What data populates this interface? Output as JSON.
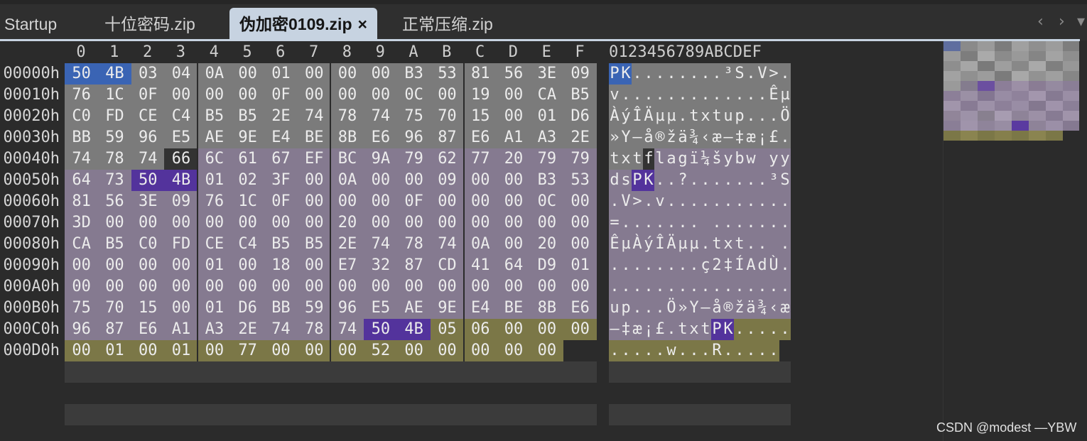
{
  "tabs": [
    {
      "label": "Startup",
      "active": false
    },
    {
      "label": "十位密码.zip",
      "active": false
    },
    {
      "label": "伪加密0109.zip",
      "active": true,
      "close_glyph": "×"
    },
    {
      "label": "正常压缩.zip",
      "active": false
    }
  ],
  "nav": {
    "prev_glyph": "‹",
    "next_glyph": "›",
    "menu_glyph": "▾"
  },
  "hex_view": {
    "column_headers": [
      "0",
      "1",
      "2",
      "3",
      "4",
      "5",
      "6",
      "7",
      "8",
      "9",
      "A",
      "B",
      "C",
      "D",
      "E",
      "F"
    ],
    "ascii_header": "0123456789ABCDEF",
    "rows": [
      {
        "offset": "00000h",
        "bytes": [
          "50",
          "4B",
          "03",
          "04",
          "0A",
          "00",
          "01",
          "00",
          "00",
          "00",
          "B3",
          "53",
          "81",
          "56",
          "3E",
          "09"
        ],
        "ascii": "PK........³S.V>."
      },
      {
        "offset": "00010h",
        "bytes": [
          "76",
          "1C",
          "0F",
          "00",
          "00",
          "00",
          "0F",
          "00",
          "00",
          "00",
          "0C",
          "00",
          "19",
          "00",
          "CA",
          "B5"
        ],
        "ascii": "v.............Êµ"
      },
      {
        "offset": "00020h",
        "bytes": [
          "C0",
          "FD",
          "CE",
          "C4",
          "B5",
          "B5",
          "2E",
          "74",
          "78",
          "74",
          "75",
          "70",
          "15",
          "00",
          "01",
          "D6"
        ],
        "ascii": "ÀýÎÄµµ.txtup...Ö"
      },
      {
        "offset": "00030h",
        "bytes": [
          "BB",
          "59",
          "96",
          "E5",
          "AE",
          "9E",
          "E4",
          "BE",
          "8B",
          "E6",
          "96",
          "87",
          "E6",
          "A1",
          "A3",
          "2E"
        ],
        "ascii": "»Y–å®žä¾‹æ–‡æ¡£."
      },
      {
        "offset": "00040h",
        "bytes": [
          "74",
          "78",
          "74",
          "66",
          "6C",
          "61",
          "67",
          "EF",
          "BC",
          "9A",
          "79",
          "62",
          "77",
          "20",
          "79",
          "79"
        ],
        "ascii": "txtflagï¼šybw yy"
      },
      {
        "offset": "00050h",
        "bytes": [
          "64",
          "73",
          "50",
          "4B",
          "01",
          "02",
          "3F",
          "00",
          "0A",
          "00",
          "00",
          "09",
          "00",
          "00",
          "B3",
          "53"
        ],
        "ascii": "dsPK..?.......³S"
      },
      {
        "offset": "00060h",
        "bytes": [
          "81",
          "56",
          "3E",
          "09",
          "76",
          "1C",
          "0F",
          "00",
          "00",
          "00",
          "0F",
          "00",
          "00",
          "00",
          "0C",
          "00"
        ],
        "ascii": ".V>.v..........."
      },
      {
        "offset": "00070h",
        "bytes": [
          "3D",
          "00",
          "00",
          "00",
          "00",
          "00",
          "00",
          "00",
          "20",
          "00",
          "00",
          "00",
          "00",
          "00",
          "00",
          "00"
        ],
        "ascii": "=....... ......."
      },
      {
        "offset": "00080h",
        "bytes": [
          "CA",
          "B5",
          "C0",
          "FD",
          "CE",
          "C4",
          "B5",
          "B5",
          "2E",
          "74",
          "78",
          "74",
          "0A",
          "00",
          "20",
          "00"
        ],
        "ascii": "ÊµÀýÎÄµµ.txt.. ."
      },
      {
        "offset": "00090h",
        "bytes": [
          "00",
          "00",
          "00",
          "00",
          "01",
          "00",
          "18",
          "00",
          "E7",
          "32",
          "87",
          "CD",
          "41",
          "64",
          "D9",
          "01"
        ],
        "ascii": "........ç2‡ÍAdÙ."
      },
      {
        "offset": "000A0h",
        "bytes": [
          "00",
          "00",
          "00",
          "00",
          "00",
          "00",
          "00",
          "00",
          "00",
          "00",
          "00",
          "00",
          "00",
          "00",
          "00",
          "00"
        ],
        "ascii": "................"
      },
      {
        "offset": "000B0h",
        "bytes": [
          "75",
          "70",
          "15",
          "00",
          "01",
          "D6",
          "BB",
          "59",
          "96",
          "E5",
          "AE",
          "9E",
          "E4",
          "BE",
          "8B",
          "E6"
        ],
        "ascii": "up...Ö»Y–å®žä¾‹æ"
      },
      {
        "offset": "000C0h",
        "bytes": [
          "96",
          "87",
          "E6",
          "A1",
          "A3",
          "2E",
          "74",
          "78",
          "74",
          "50",
          "4B",
          "05",
          "06",
          "00",
          "00",
          "00"
        ],
        "ascii": "–‡æ¡£.txtPK....."
      },
      {
        "offset": "000D0h",
        "bytes": [
          "00",
          "01",
          "00",
          "01",
          "00",
          "77",
          "00",
          "00",
          "00",
          "52",
          "00",
          "00",
          "00",
          "00",
          "00"
        ],
        "ascii": ".....w...R....."
      }
    ]
  },
  "colors": {
    "gray": "#7b7b7b",
    "purple": "#857a90",
    "olive": "#7b7747",
    "dark": "#333333",
    "pk_blue": "#3a64b4",
    "pk_purple": "#53339c"
  },
  "watermark": "CSDN @modest —YBW"
}
